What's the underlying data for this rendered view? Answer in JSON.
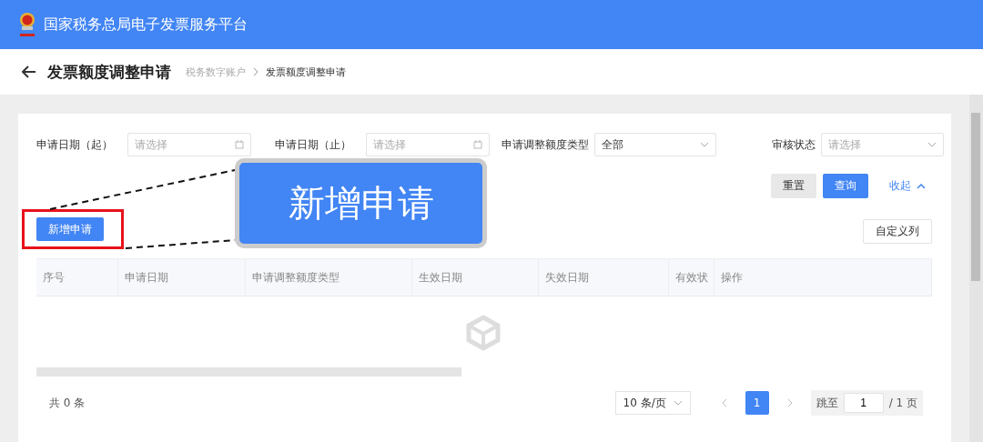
{
  "header": {
    "title": "国家税务总局电子发票服务平台"
  },
  "page": {
    "title": "发票额度调整申请",
    "breadcrumb": [
      "税务数字账户",
      "发票额度调整申请"
    ]
  },
  "filters": [
    {
      "kind": "date",
      "label": "申请日期（起）",
      "placeholder": "请选择"
    },
    {
      "kind": "date",
      "label": "申请日期（止）",
      "placeholder": "请选择"
    },
    {
      "kind": "select",
      "label": "申请调整额度类型",
      "value": "全部"
    },
    {
      "kind": "select",
      "label": "审核状态",
      "placeholder": "请选择"
    }
  ],
  "actions": {
    "reset": "重置",
    "query": "查询",
    "collapse": "收起"
  },
  "toolbar": {
    "new": "新增申请",
    "columns": "自定义列"
  },
  "callout": {
    "text": "新增申请"
  },
  "table": {
    "columns": [
      "序号",
      "申请日期",
      "申请调整额度类型",
      "生效日期",
      "失效日期",
      "有效状",
      "操作"
    ]
  },
  "pagination": {
    "total": "共 0 条",
    "page_size": "10 条/页",
    "pages": [
      {
        "label": "1",
        "selected": true
      }
    ],
    "jump_label": "跳至",
    "jump_value": "1",
    "page_count": "/ 1 页"
  }
}
